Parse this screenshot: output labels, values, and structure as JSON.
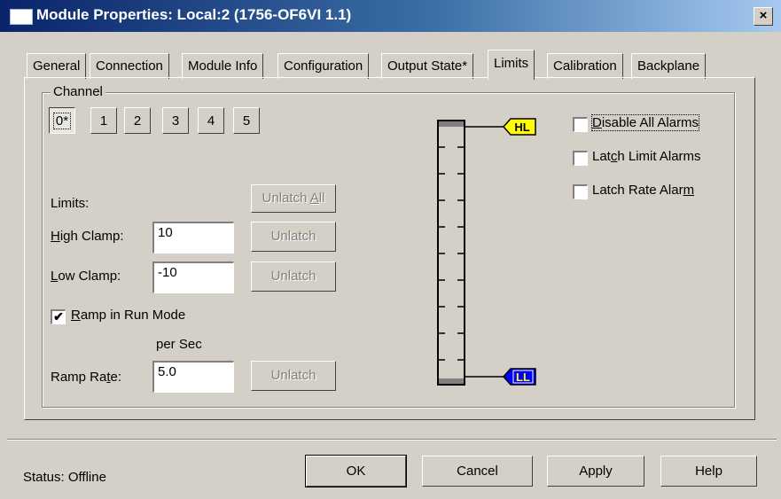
{
  "window": {
    "title": "Module Properties: Local:2 (1756-OF6VI 1.1)",
    "close_glyph": "×"
  },
  "tabs": [
    {
      "label": "General"
    },
    {
      "label": "Connection"
    },
    {
      "label": "Module Info"
    },
    {
      "label": "Configuration"
    },
    {
      "label": "Output State*"
    },
    {
      "label": "Limits"
    },
    {
      "label": "Calibration"
    },
    {
      "label": "Backplane"
    }
  ],
  "active_tab": "Limits",
  "channel": {
    "group_label": "Channel",
    "buttons": [
      "0*",
      "1",
      "2",
      "3",
      "4",
      "5"
    ],
    "selected": "0*"
  },
  "limits": {
    "heading": "Limits:",
    "unlatch_all_prefix": "Unlatch ",
    "unlatch_all_key": "A",
    "unlatch_all_suffix": "ll",
    "high_clamp_key": "H",
    "high_clamp_rest": "igh Clamp:",
    "high_clamp_value": "10",
    "low_clamp_key": "L",
    "low_clamp_rest": "ow Clamp:",
    "low_clamp_value": "-10",
    "unlatch_label": "Unlatch",
    "ramp_checked": true,
    "ramp_key": "R",
    "ramp_rest": "amp in Run Mode",
    "per_sec": "per Sec",
    "ramp_rate_prefix": "Ramp Ra",
    "ramp_rate_key": "t",
    "ramp_rate_suffix": "e:",
    "ramp_rate_value": "5.0"
  },
  "gauge": {
    "hl_label": "HL",
    "ll_label": "LL"
  },
  "alarms": {
    "disable_key": "D",
    "disable_rest": "isable All Alarms",
    "disable_checked": false,
    "latch_limit_prefix": "Lat",
    "latch_limit_key": "c",
    "latch_limit_suffix": "h Limit Alarms",
    "latch_limit_checked": false,
    "latch_rate_prefix": "Latch Rate Alar",
    "latch_rate_key": "m",
    "latch_rate_checked": false
  },
  "footer": {
    "status": "Status:  Offline",
    "ok": "OK",
    "cancel": "Cancel",
    "apply": "Apply",
    "help": "Help"
  },
  "colors": {
    "title_bar": "#0a246a",
    "face": "#d4d0c8",
    "hl_flag": "#ffff00",
    "ll_flag": "#0000ff"
  }
}
